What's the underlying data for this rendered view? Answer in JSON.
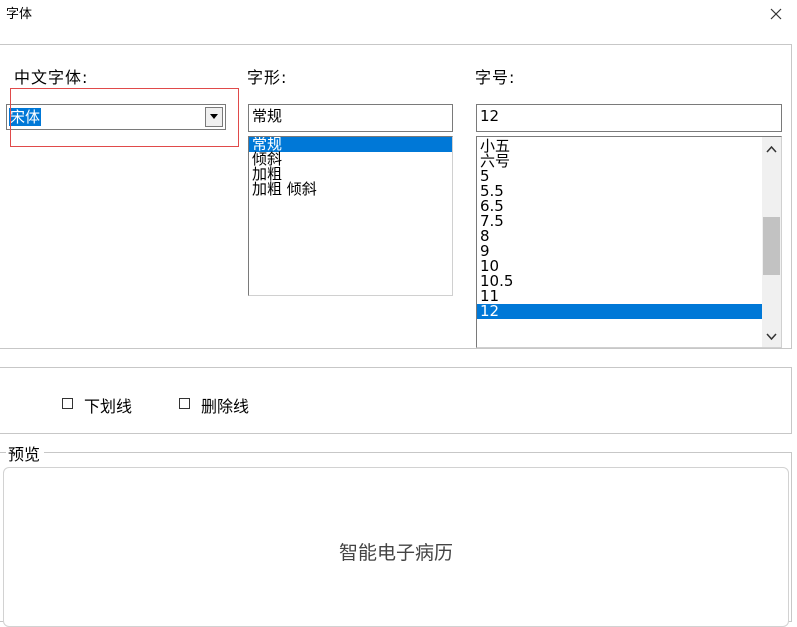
{
  "window": {
    "title": "字体"
  },
  "labels": {
    "chinese_font": "中文字体:",
    "style": "字形:",
    "size": "字号:"
  },
  "chinese_font": {
    "value": "宋体"
  },
  "style": {
    "value": "常规",
    "options": [
      {
        "label": "常规",
        "selected": true
      },
      {
        "label": "倾斜",
        "selected": false
      },
      {
        "label": "加粗",
        "selected": false
      },
      {
        "label": "加粗 倾斜",
        "selected": false
      }
    ]
  },
  "size": {
    "value": "12",
    "options": [
      {
        "label": "小五",
        "selected": false
      },
      {
        "label": "六号",
        "selected": false
      },
      {
        "label": "5",
        "selected": false
      },
      {
        "label": "5.5",
        "selected": false
      },
      {
        "label": "6.5",
        "selected": false
      },
      {
        "label": "7.5",
        "selected": false
      },
      {
        "label": "8",
        "selected": false
      },
      {
        "label": "9",
        "selected": false
      },
      {
        "label": "10",
        "selected": false
      },
      {
        "label": "10.5",
        "selected": false
      },
      {
        "label": "11",
        "selected": false
      },
      {
        "label": "12",
        "selected": true
      }
    ]
  },
  "effects": {
    "underline": {
      "label": "下划线",
      "checked": false
    },
    "strikethrough": {
      "label": "删除线",
      "checked": false
    }
  },
  "preview": {
    "title": "预览",
    "sample_text": "智能电子病历"
  },
  "colors": {
    "selection": "#0078d7",
    "highlight_box": "#e04a4a",
    "border": "#c7c7c7"
  },
  "icons": {
    "close": "close-icon",
    "dropdown": "chevron-down-icon",
    "scroll_up": "chevron-up-icon",
    "scroll_down": "chevron-down-icon"
  }
}
